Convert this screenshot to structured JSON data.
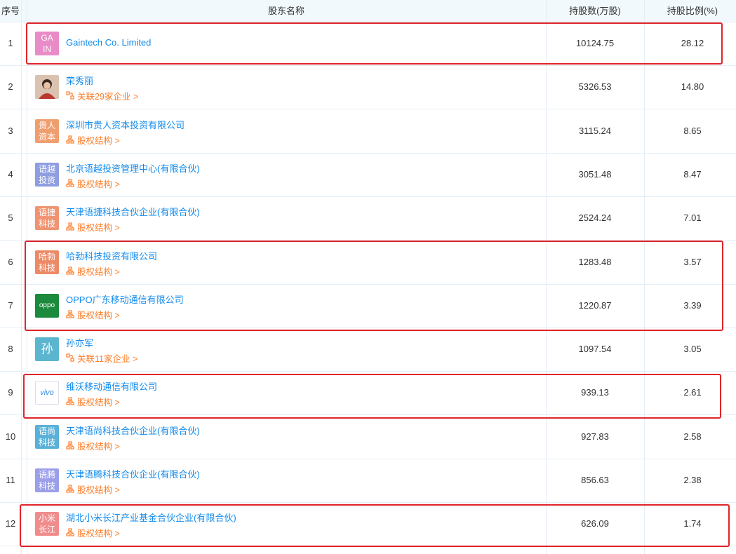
{
  "header": {
    "idx": "序号",
    "name": "股东名称",
    "shares": "持股数(万股)",
    "ratio": "持股比例(%)"
  },
  "rows": [
    {
      "idx": "1",
      "logo_text": "GA IN",
      "logo_color": "#e98bc7",
      "name": "Gaintech Co. Limited",
      "sub": "",
      "shares": "10124.75",
      "ratio": "28.12"
    },
    {
      "idx": "2",
      "logo_text": "",
      "logo_color": "#6a4b3a",
      "name": "荣秀丽",
      "sub": "关联29家企业 >",
      "sub_icon": "relation-icon",
      "shares": "5326.53",
      "ratio": "14.80"
    },
    {
      "idx": "3",
      "logo_text": "贵人资本",
      "logo_color": "#ef9f6f",
      "name": "深圳市贵人资本投资有限公司",
      "sub": "股权结构 >",
      "sub_icon": "structure-icon",
      "shares": "3115.24",
      "ratio": "8.65"
    },
    {
      "idx": "4",
      "logo_text": "语越投资",
      "logo_color": "#8f9ee0",
      "name": "北京语越投资管理中心(有限合伙)",
      "sub": "股权结构 >",
      "sub_icon": "structure-icon",
      "shares": "3051.48",
      "ratio": "8.47"
    },
    {
      "idx": "5",
      "logo_text": "语捷科技",
      "logo_color": "#ef9372",
      "name": "天津语捷科技合伙企业(有限合伙)",
      "sub": "股权结构 >",
      "sub_icon": "structure-icon",
      "shares": "2524.24",
      "ratio": "7.01"
    },
    {
      "idx": "6",
      "logo_text": "哈勃科技",
      "logo_color": "#ec8a67",
      "name": "哈勃科技投资有限公司",
      "sub": "股权结构 >",
      "sub_icon": "structure-icon",
      "shares": "1283.48",
      "ratio": "3.57"
    },
    {
      "idx": "7",
      "logo_text": "oppo",
      "logo_color": "#1b8a3d",
      "name": "OPPO广东移动通信有限公司",
      "sub": "股权结构 >",
      "sub_icon": "structure-icon",
      "shares": "1220.87",
      "ratio": "3.39"
    },
    {
      "idx": "8",
      "logo_text": "孙",
      "logo_color": "#5bb5cf",
      "name": "孙亦军",
      "sub": "关联11家企业 >",
      "sub_icon": "relation-icon",
      "shares": "1097.54",
      "ratio": "3.05"
    },
    {
      "idx": "9",
      "logo_text": "vivo",
      "logo_color": "#ffffff",
      "name": "维沃移动通信有限公司",
      "sub": "股权结构 >",
      "sub_icon": "structure-icon",
      "shares": "939.13",
      "ratio": "2.61"
    },
    {
      "idx": "10",
      "logo_text": "语尚科技",
      "logo_color": "#5ab1d8",
      "name": "天津语尚科技合伙企业(有限合伙)",
      "sub": "股权结构 >",
      "sub_icon": "structure-icon",
      "shares": "927.83",
      "ratio": "2.58"
    },
    {
      "idx": "11",
      "logo_text": "语腾科技",
      "logo_color": "#9b9ee8",
      "name": "天津语腾科技合伙企业(有限合伙)",
      "sub": "股权结构 >",
      "sub_icon": "structure-icon",
      "shares": "856.63",
      "ratio": "2.38"
    },
    {
      "idx": "12",
      "logo_text": "小米长江",
      "logo_color": "#f08c8c",
      "name": "湖北小米长江产业基金合伙企业(有限合伙)",
      "sub": "股权结构 >",
      "sub_icon": "structure-icon",
      "shares": "626.09",
      "ratio": "1.74"
    }
  ],
  "colors": {
    "link": "#128bed",
    "sub": "#fd7f2c",
    "highlight": "#e0242a",
    "header_bg": "#f2f9fc"
  }
}
